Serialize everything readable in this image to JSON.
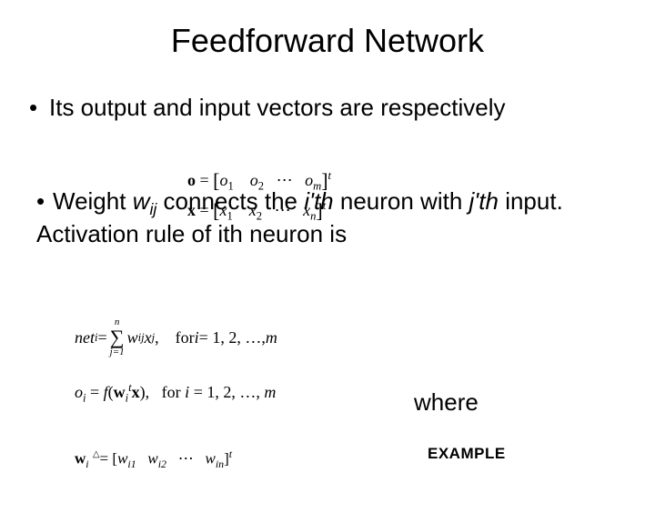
{
  "title": "Feedforward Network",
  "bullet1": {
    "dot": "•",
    "text": "Its output and input vectors are respectively"
  },
  "bullet2": {
    "dot": "•",
    "prefix": "Weight ",
    "w": "w",
    "w_sub": "ij",
    "mid": " connects the ",
    "ith": "i'th",
    "mid2": " neuron with ",
    "jth": "j'th",
    "tail": " input. Activation rule of ith neuron is"
  },
  "eq1": {
    "o_bold": "o",
    "eq": " = ",
    "lbr": "[",
    "o1": "o",
    "o1s": "1",
    "o2": "o",
    "o2s": "2",
    "dots": "⋯",
    "om": "o",
    "oms": "m",
    "rbr": "]",
    "t": "t",
    "x_bold": "x",
    "x1": "x",
    "x1s": "1",
    "x2": "x",
    "x2s": "2",
    "xn": "x",
    "xns": "n"
  },
  "eq2": {
    "net": "net",
    "net_sub": "i",
    "eq": " = ",
    "sum_top": "n",
    "sum_sym": "∑",
    "sum_bot": "j=1",
    "w": "w",
    "w_sub": "ij",
    "x": "x",
    "x_sub": "j",
    "comma": ",",
    "for": "for ",
    "i": "i",
    "range": " = 1, 2, …, ",
    "m": "m"
  },
  "eq3": {
    "o": "o",
    "o_sub": "i",
    "eq": " = ",
    "f": "f",
    "lp": "(",
    "w": "w",
    "w_sub": "i",
    "w_sup": "t",
    "x": "x",
    "rp": "),",
    "for": "for ",
    "i": "i",
    "range": " = 1, 2, …, ",
    "m": "m"
  },
  "eq4": {
    "w": "w",
    "w_sub": "i",
    "tri": "△",
    "eq": "= ",
    "lbr": "[",
    "w1": "w",
    "w1s": "i1",
    "w2": "w",
    "w2s": "i2",
    "dots": "⋯",
    "wn": "w",
    "wns": "in",
    "rbr": "]",
    "t": "t"
  },
  "where": "where",
  "example": "EXAMPLE"
}
